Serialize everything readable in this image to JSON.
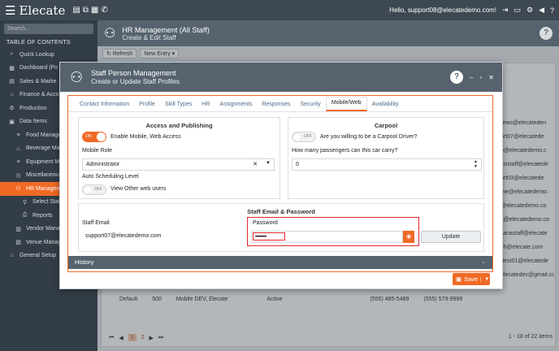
{
  "topbar": {
    "brand": "Elecate",
    "greeting": "Hello, support08@elecatedemo.com!"
  },
  "sidebar": {
    "search_placeholder": "Search...",
    "toc": "TABLE OF CONTENTS",
    "items": [
      {
        "label": "Quick Lookup",
        "icon": "search-icon",
        "level": 0
      },
      {
        "label": "Dashboard (Po",
        "icon": "dashboard-icon",
        "level": 0
      },
      {
        "label": "Sales & Marke",
        "icon": "chart-icon",
        "level": 0
      },
      {
        "label": "Finance & Acco",
        "icon": "bank-icon",
        "level": 0
      },
      {
        "label": "Production",
        "icon": "production-icon",
        "level": 0
      },
      {
        "label": "Data Items",
        "icon": "folder-icon",
        "level": 0
      },
      {
        "label": "Food Manage",
        "icon": "list-icon",
        "level": 1
      },
      {
        "label": "Beverage Ma",
        "icon": "beverage-icon",
        "level": 1
      },
      {
        "label": "Equipment M",
        "icon": "list-icon",
        "level": 1
      },
      {
        "label": "Miscellaneou",
        "icon": "clock-icon",
        "level": 1
      },
      {
        "label": "HR Managem",
        "icon": "people-icon",
        "level": 1,
        "active": true
      },
      {
        "label": "Select Staff",
        "icon": "person-icon",
        "level": 2
      },
      {
        "label": "Reports",
        "icon": "print-icon",
        "level": 2
      },
      {
        "label": "Vendor Mana",
        "icon": "vendor-icon",
        "level": 1
      },
      {
        "label": "Venue Manag",
        "icon": "venue-icon",
        "level": 1
      },
      {
        "label": "General Setup",
        "icon": "setup-icon",
        "level": 0
      }
    ]
  },
  "main": {
    "title": "HR Management (All Staff)",
    "subtitle": "Create & Edit Staff",
    "refresh": "Refresh",
    "new_entry": "New Entry",
    "bg_emails": [
      "rews@elecateden",
      "ort07@elecatede",
      "o@elecatedemo.c",
      "trostaff@elecatede",
      "ort03@elecatede",
      "me@elecatedemo.",
      "@elecatedemo.co",
      "s@elecatedemo.co",
      "llanastaff@elecate",
      "sh@elecate.com",
      "rtest01@elecatede",
      "elecatedev@gmail.com"
    ],
    "pager_pages": [
      "1",
      "2"
    ],
    "pager_info": "1 - 18 of 22 items",
    "bg_row": [
      "Default",
      "500",
      "Mobile DEV, Elecate",
      "Active",
      "(555) 485-5489",
      "(555) 579-9999"
    ]
  },
  "modal": {
    "title": "Staff Person Management",
    "subtitle": "Create or Update Staff Profiles",
    "tabs": [
      "Contact Information",
      "Profile",
      "Skill Types",
      "HR",
      "Assignments",
      "Responses",
      "Security",
      "Mobile/Web",
      "Availability"
    ],
    "active_tab": "Mobile/Web",
    "access": {
      "heading": "Access and Publishing",
      "toggle_on_text": "ON",
      "enable_label": "Enable Mobile, Web Access",
      "role_label": "Mobile Role",
      "role_value": "Administrator",
      "sched_label": "Auto Scheduling Level",
      "toggle_off_text": "OFF",
      "view_label": "View Other web users"
    },
    "carpool": {
      "heading": "Carpool",
      "toggle_text": "OFF",
      "question": "Are you willing to be a Carpool Driver?",
      "passengers_label": "How many passengers can this car carry?",
      "passengers_value": "0"
    },
    "email_pw": {
      "heading": "Staff Email & Password",
      "email_label": "Staff Email",
      "email_value": "support07@elecatedemo.com",
      "password_label": "Password",
      "password_value": "••••••••••••",
      "update_label": "Update"
    },
    "history": "History",
    "save": "Save"
  },
  "colors": {
    "accent": "#f06a25",
    "header": "#56636f",
    "highlight": "#e0282e"
  }
}
